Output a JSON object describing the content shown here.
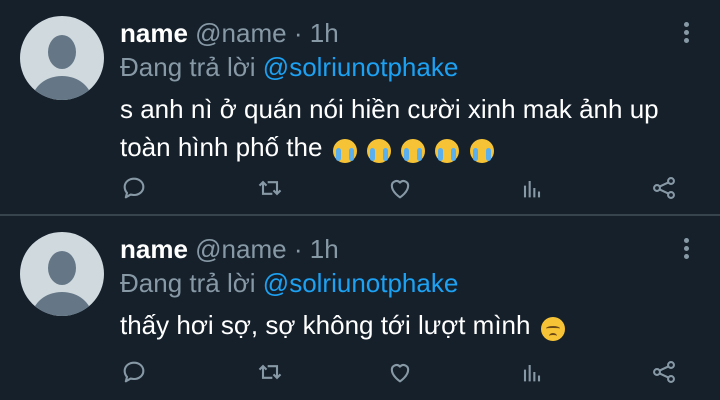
{
  "tweets": [
    {
      "display_name": "name",
      "handle": "@name",
      "separator": "·",
      "time": "1h",
      "reply_prefix": "Đang trả lời",
      "reply_to": "@solriunotphake",
      "text": "s anh nì ở quán nói hiền cười xinh mak ảnh up toàn hình phố the",
      "emojis": [
        "loudly-crying-face",
        "loudly-crying-face",
        "loudly-crying-face",
        "loudly-crying-face",
        "loudly-crying-face"
      ]
    },
    {
      "display_name": "name",
      "handle": "@name",
      "separator": "·",
      "time": "1h",
      "reply_prefix": "Đang trả lời",
      "reply_to": "@solriunotphake",
      "text": "thấy hơi sợ, sợ không tới lượt mình",
      "emojis": [
        "disappointed-face"
      ]
    }
  ],
  "icons": {
    "reply": "reply-icon",
    "retweet": "retweet-icon",
    "like": "like-icon",
    "stats": "stats-icon",
    "share": "share-icon",
    "more": "more-options-icon"
  },
  "colors": {
    "background": "#15202b",
    "divider": "#38444d",
    "muted": "#8899a6",
    "mention": "#1da1f2"
  }
}
